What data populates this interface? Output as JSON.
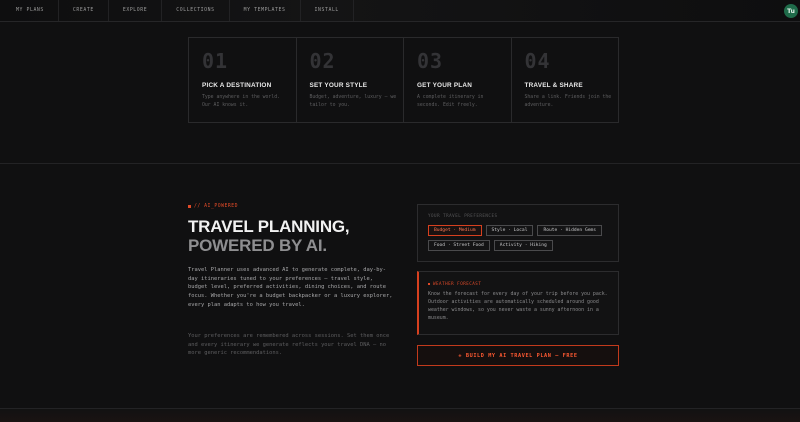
{
  "nav": {
    "items": [
      "MY PLANS",
      "CREATE",
      "EXPLORE",
      "COLLECTIONS",
      "MY TEMPLATES",
      "INSTALL"
    ],
    "avatar_initials": "Tu"
  },
  "steps": [
    {
      "num": "01",
      "title": "PICK A DESTINATION",
      "desc": "Type anywhere in the world. Our AI knows it."
    },
    {
      "num": "02",
      "title": "SET YOUR STYLE",
      "desc": "Budget, adventure, luxury — we tailor to you."
    },
    {
      "num": "03",
      "title": "GET YOUR PLAN",
      "desc": "A complete itinerary in seconds. Edit freely."
    },
    {
      "num": "04",
      "title": "TRAVEL & SHARE",
      "desc": "Share a link. Friends join the adventure."
    }
  ],
  "feature": {
    "tag": "// AI_POWERED",
    "headline_1": "TRAVEL PLANNING,",
    "headline_2": "POWERED BY AI.",
    "para_1": "Travel Planner uses advanced AI to generate complete, day-by-day itineraries tuned to your preferences — travel style, budget level, preferred activities, dining choices, and route focus. Whether you're a budget backpacker or a luxury explorer, every plan adapts to how you travel.",
    "para_2": "Your preferences are remembered across sessions. Set them once and every itinerary we generate reflects your travel DNA — no more generic recommendations."
  },
  "preferences": {
    "label": "YOUR TRAVEL PREFERENCES",
    "chips": [
      {
        "text": "Budget · Medium",
        "active": true
      },
      {
        "text": "Style · Local",
        "active": false
      },
      {
        "text": "Route · Hidden Gems",
        "active": false
      },
      {
        "text": "Food · Street Food",
        "active": false
      },
      {
        "text": "Activity · Hiking",
        "active": false
      }
    ]
  },
  "weather": {
    "title": "WEATHER FORECAST",
    "text": "Know the forecast for every day of your trip before you pack. Outdoor activities are automatically scheduled around good weather windows, so you never waste a sunny afternoon in a museum."
  },
  "cta": {
    "label": "+ BUILD MY AI TRAVEL PLAN — FREE"
  },
  "colors": {
    "accent": "#e04a28",
    "background": "#101011",
    "avatar": "#1f6b4a"
  }
}
